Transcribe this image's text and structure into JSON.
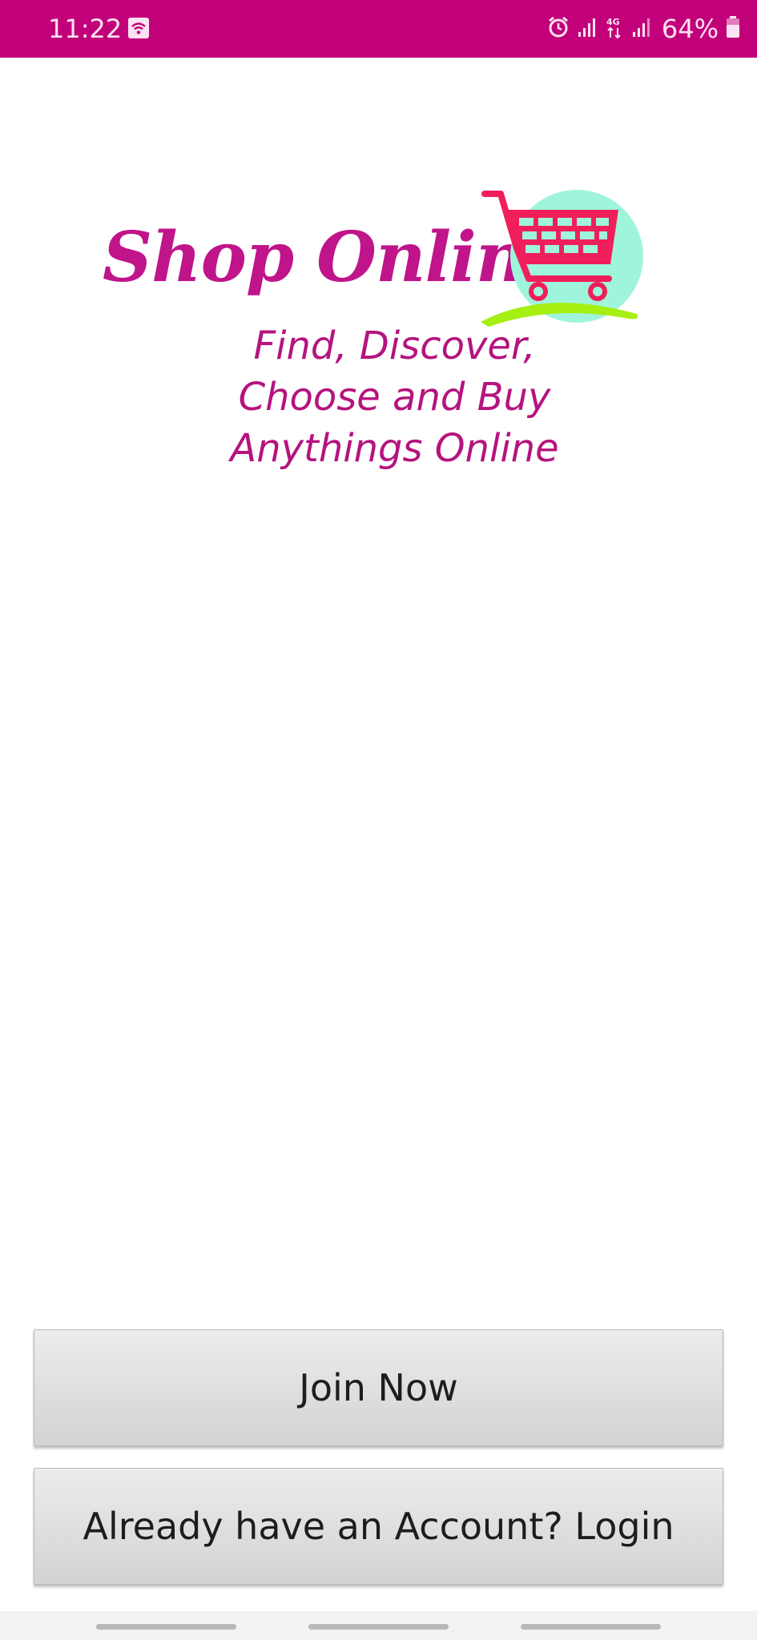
{
  "status_bar": {
    "time": "11:22",
    "battery": "64%",
    "background_color": "#c2007a",
    "icons": [
      "wifi-icon",
      "alarm-icon",
      "signal-icon",
      "4g-icon",
      "signal-icon",
      "battery-icon"
    ]
  },
  "logo": {
    "title": "Shop Online",
    "brand_color": "#c0148a",
    "icon": "shopping-cart-icon"
  },
  "tagline": {
    "line1": "Find, Discover,",
    "line2": "Choose and Buy",
    "line3": "Anythings Online"
  },
  "buttons": {
    "join": "Join Now",
    "login": "Already have an Account? Login"
  }
}
